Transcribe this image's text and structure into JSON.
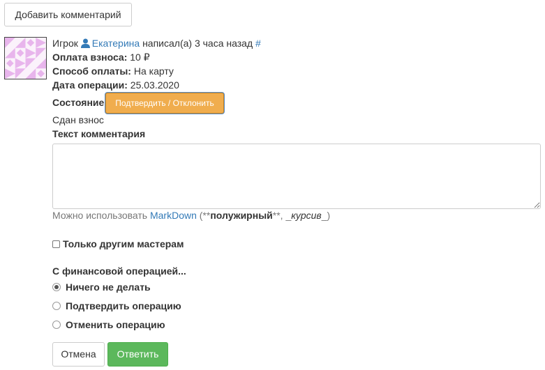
{
  "toolbar": {
    "add_comment_label": "Добавить комментарий"
  },
  "comment": {
    "prefix": "Игрок",
    "author": "Екатерина",
    "action": "написал(а) 3 часа назад",
    "anchor": "#",
    "fee_label": "Оплата взноса:",
    "fee_value": "10 ₽",
    "method_label": "Способ оплаты:",
    "method_value": "На карту",
    "date_label": "Дата операции:",
    "date_value": "25.03.2020",
    "state_label": "Состояние:",
    "state_button": "Подтвердить / Отклонить",
    "body": "Сдан взнос"
  },
  "form": {
    "text_label": "Текст комментария",
    "text_value": "",
    "hint_prefix": "Можно использовать",
    "hint_link": "MarkDown",
    "hint_open": "(**",
    "hint_bold": "полужирный",
    "hint_mid": "**, _",
    "hint_italic": "курсив",
    "hint_close": "_)",
    "only_masters_label": "Только другим мастерам",
    "only_masters_checked": false,
    "finance_label": "С финансовой операцией...",
    "finance_options": [
      {
        "label": "Ничего не делать",
        "checked": true
      },
      {
        "label": "Подтвердить операцию",
        "checked": false
      },
      {
        "label": "Отменить операцию",
        "checked": false
      }
    ],
    "cancel_label": "Отмена",
    "reply_label": "Ответить"
  },
  "colors": {
    "link": "#337ab7",
    "warning_button": "#f0ad4e",
    "success_button": "#5cb85c",
    "avatar_pattern": "#e8b5ec"
  },
  "icons": {
    "user": "user-icon",
    "avatar": "identicon-avatar"
  }
}
